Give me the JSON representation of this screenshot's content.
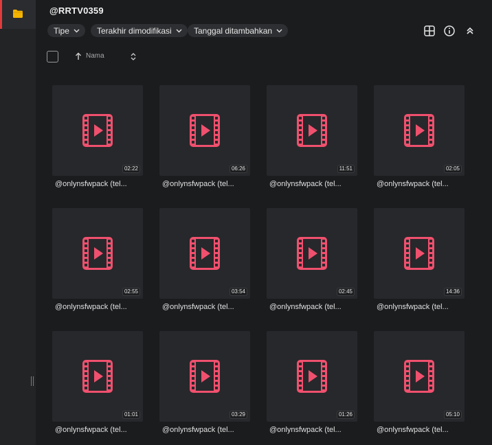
{
  "header": {
    "title": "@RRTV0359"
  },
  "filters": [
    {
      "label": "Tipe"
    },
    {
      "label": "Terakhir dimodifikasi"
    },
    {
      "label": "Tanggal ditambahkan"
    }
  ],
  "sort": {
    "label": "Nama"
  },
  "files": [
    {
      "name": "@onlynsfwpack (tel...",
      "duration": "02:22"
    },
    {
      "name": "@onlynsfwpack (tel...",
      "duration": "06:26"
    },
    {
      "name": "@onlynsfwpack (tel...",
      "duration": "11:51"
    },
    {
      "name": "@onlynsfwpack (tel...",
      "duration": "02:05"
    },
    {
      "name": "@onlynsfwpack (tel...",
      "duration": "02:55"
    },
    {
      "name": "@onlynsfwpack (tel...",
      "duration": "03:54"
    },
    {
      "name": "@onlynsfwpack (tel...",
      "duration": "02:45"
    },
    {
      "name": "@onlynsfwpack (tel...",
      "duration": "14:36"
    },
    {
      "name": "@onlynsfwpack (tel...",
      "duration": "01:01"
    },
    {
      "name": "@onlynsfwpack (tel...",
      "duration": "03:29"
    },
    {
      "name": "@onlynsfwpack (tel...",
      "duration": "01:26"
    },
    {
      "name": "@onlynsfwpack (tel...",
      "duration": "05:10"
    }
  ],
  "colors": {
    "accent": "#e23b3b",
    "video_icon": "#f0506e",
    "folder": "#f5b400"
  },
  "icons": {
    "rail": "folder-icon",
    "toolbar": [
      "grid-view-icon",
      "info-icon",
      "collapse-icon"
    ],
    "sort_direction": "arrow-up-icon",
    "sort_toggle": "sort-toggle-icon",
    "file_thumbnail": "video-file-icon"
  }
}
